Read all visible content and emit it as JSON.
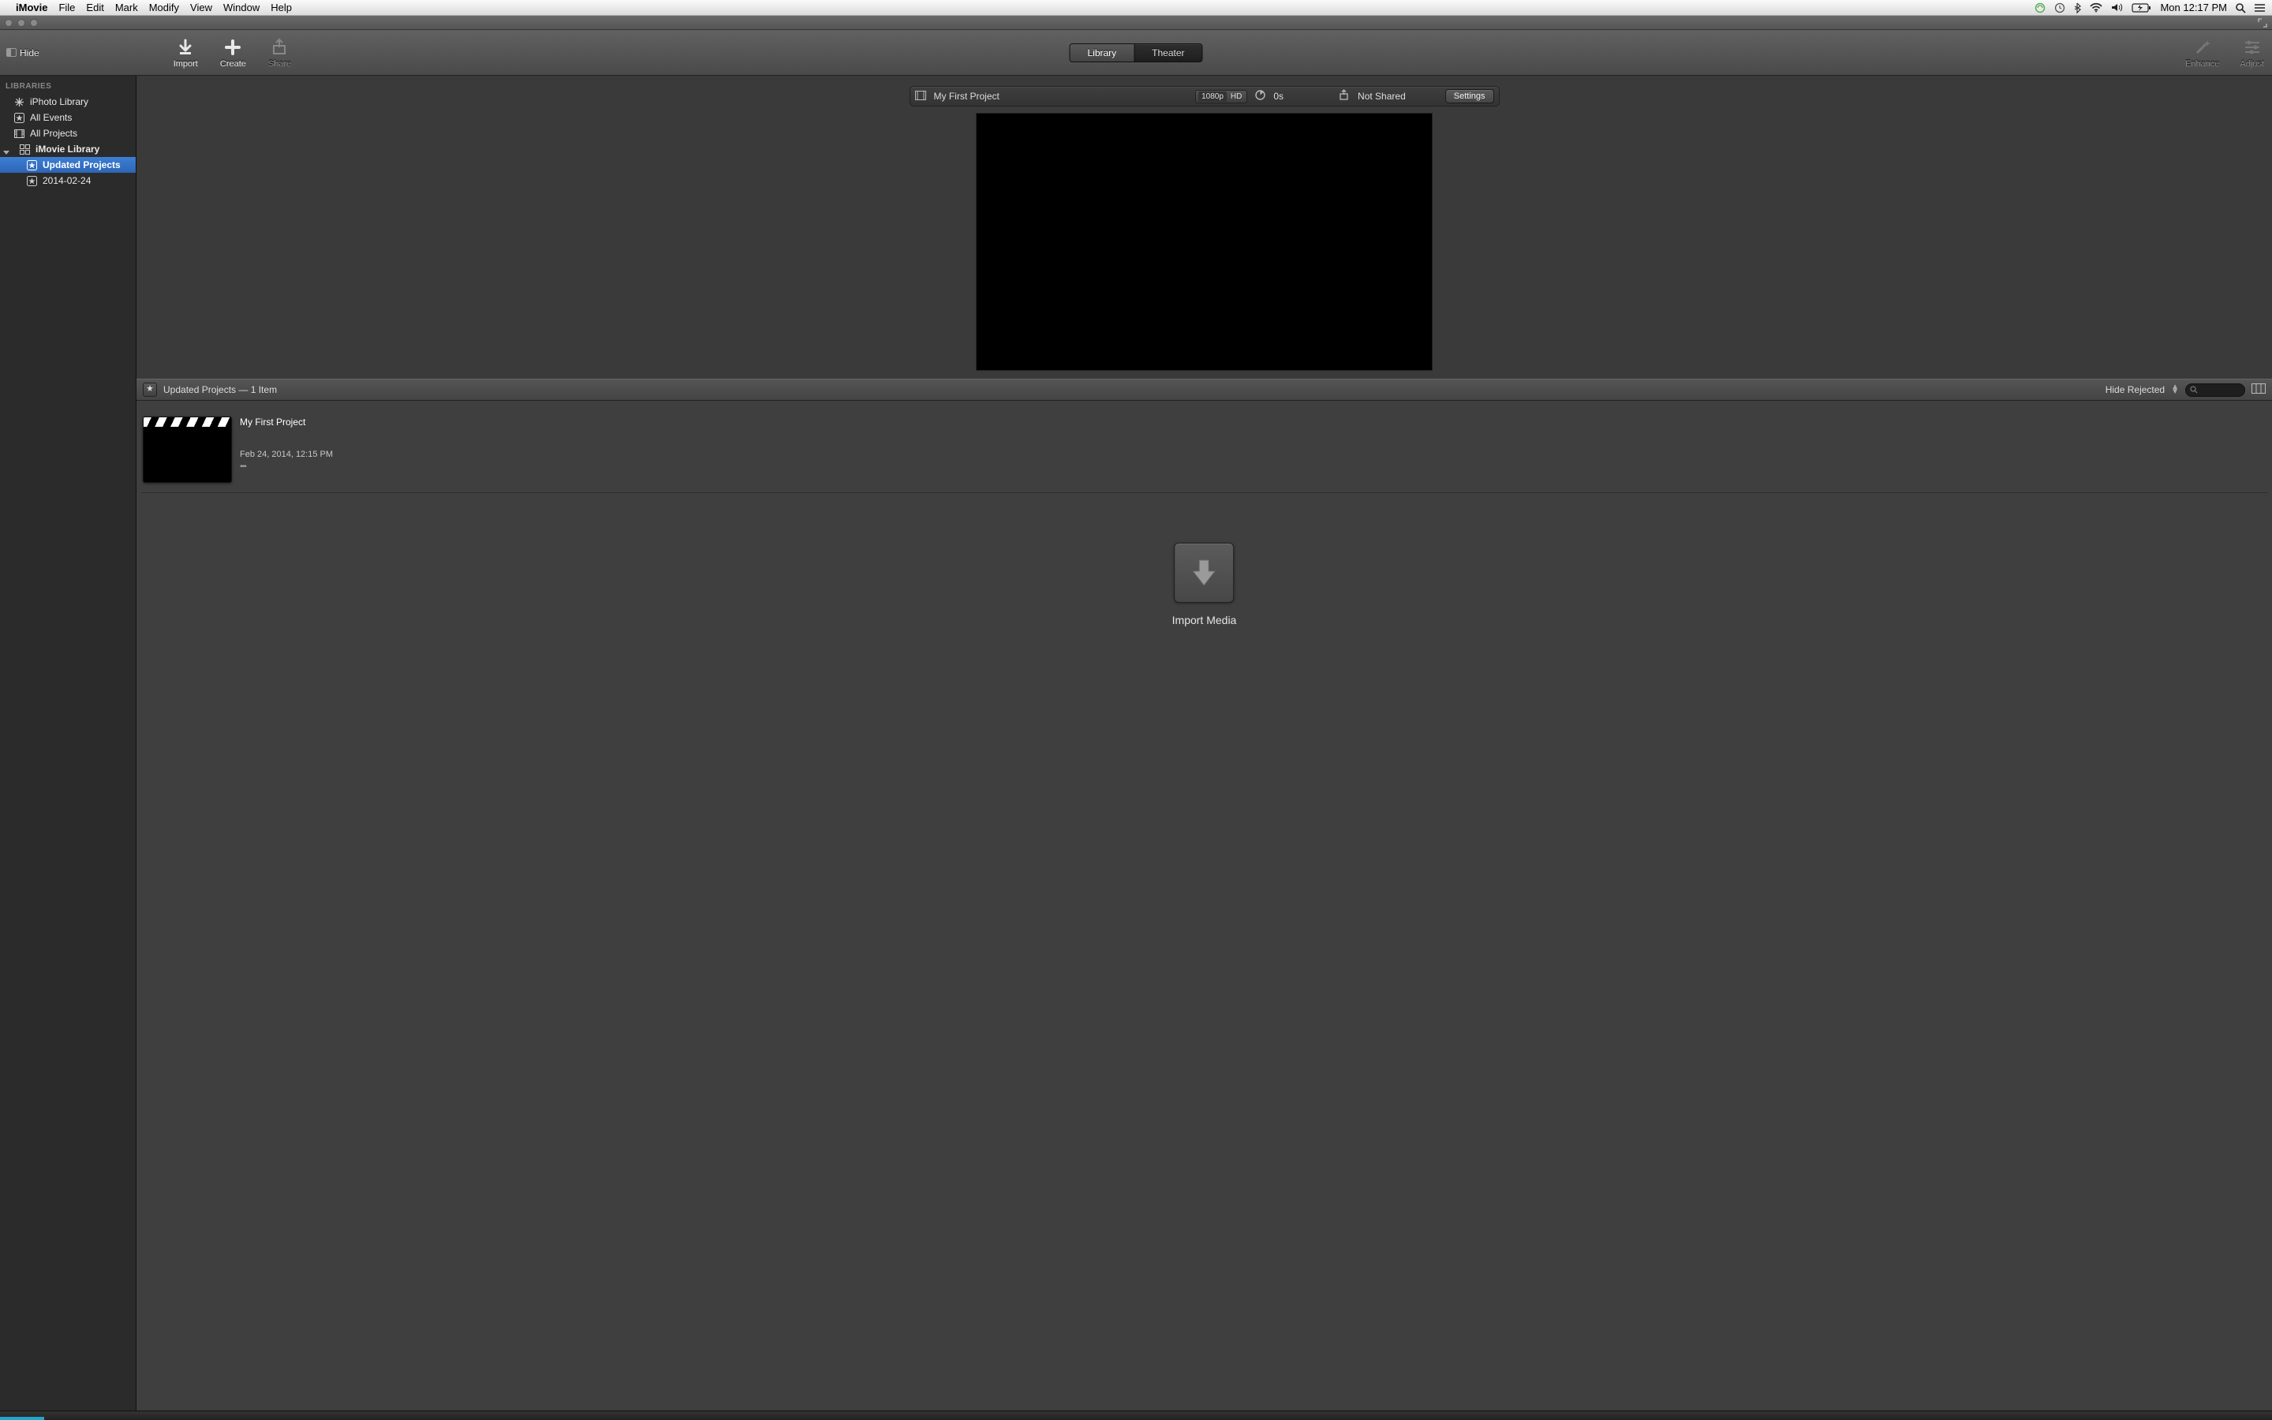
{
  "menubar": {
    "app": "iMovie",
    "items": [
      "File",
      "Edit",
      "Mark",
      "Modify",
      "View",
      "Window",
      "Help"
    ],
    "clock": "Mon 12:17 PM"
  },
  "toolbar": {
    "hide": "Hide",
    "import": "Import",
    "create": "Create",
    "share": "Share",
    "enhance": "Enhance",
    "adjust": "Adjust",
    "tabs": {
      "library": "Library",
      "theater": "Theater"
    }
  },
  "sidebar": {
    "section": "LIBRARIES",
    "items": [
      {
        "label": "iPhoto Library",
        "icon": "photos"
      },
      {
        "label": "All Events",
        "icon": "star"
      },
      {
        "label": "All Projects",
        "icon": "film"
      },
      {
        "label": "iMovie Library",
        "icon": "grid",
        "bold": true,
        "disclosure": true
      },
      {
        "label": "Updated Projects",
        "icon": "star",
        "bold": true,
        "selected": true,
        "level": 2
      },
      {
        "label": "2014-02-24",
        "icon": "star",
        "level": 2
      }
    ]
  },
  "project_bar": {
    "name": "My First Project",
    "resolution": "1080p",
    "badge": "HD",
    "duration": "0s",
    "share_status": "Not Shared",
    "settings": "Settings"
  },
  "browser_header": {
    "title": "Updated Projects — 1 Item",
    "hide_rejected": "Hide Rejected"
  },
  "project_card": {
    "title": "My First Project",
    "date": "Feb 24, 2014, 12:15 PM"
  },
  "import_zone": {
    "label": "Import Media"
  }
}
